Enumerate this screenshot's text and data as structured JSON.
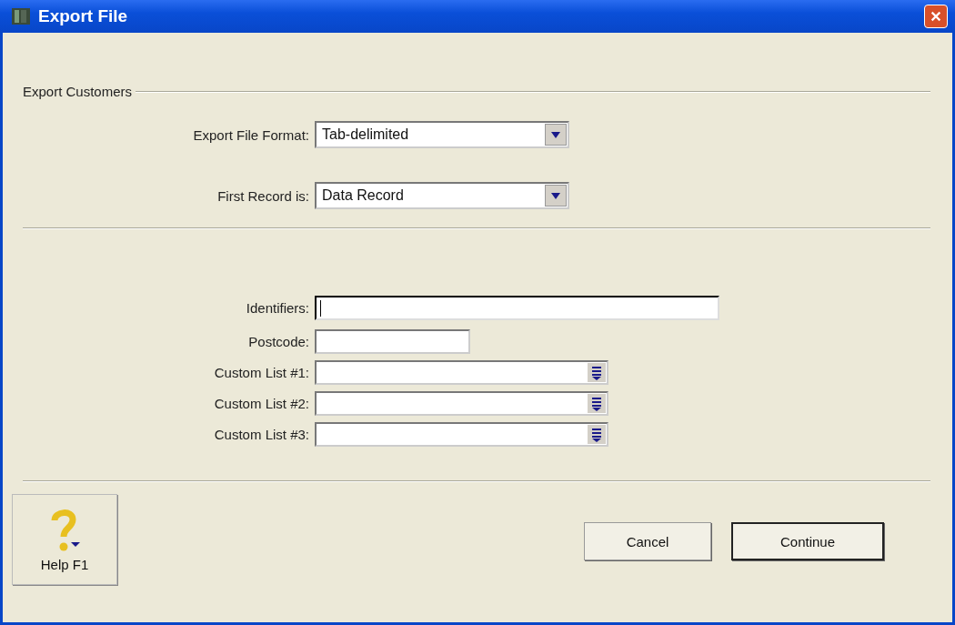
{
  "window": {
    "title": "Export File"
  },
  "group": {
    "label": "Export Customers"
  },
  "format_fields": [
    {
      "label": "Export File Format:",
      "value": "Tab-delimited"
    },
    {
      "label": "First Record is:",
      "value": "Data Record"
    }
  ],
  "filter_fields": [
    {
      "label": "Identifiers:",
      "kind": "text",
      "focused": true
    },
    {
      "label": "Postcode:",
      "kind": "text",
      "focused": false
    },
    {
      "label": "Custom List #1:",
      "kind": "list",
      "focused": false
    },
    {
      "label": "Custom List #2:",
      "kind": "list",
      "focused": false
    },
    {
      "label": "Custom List #3:",
      "kind": "list",
      "focused": false
    }
  ],
  "buttons": {
    "help": "Help F1",
    "cancel": "Cancel",
    "continue": "Continue"
  }
}
